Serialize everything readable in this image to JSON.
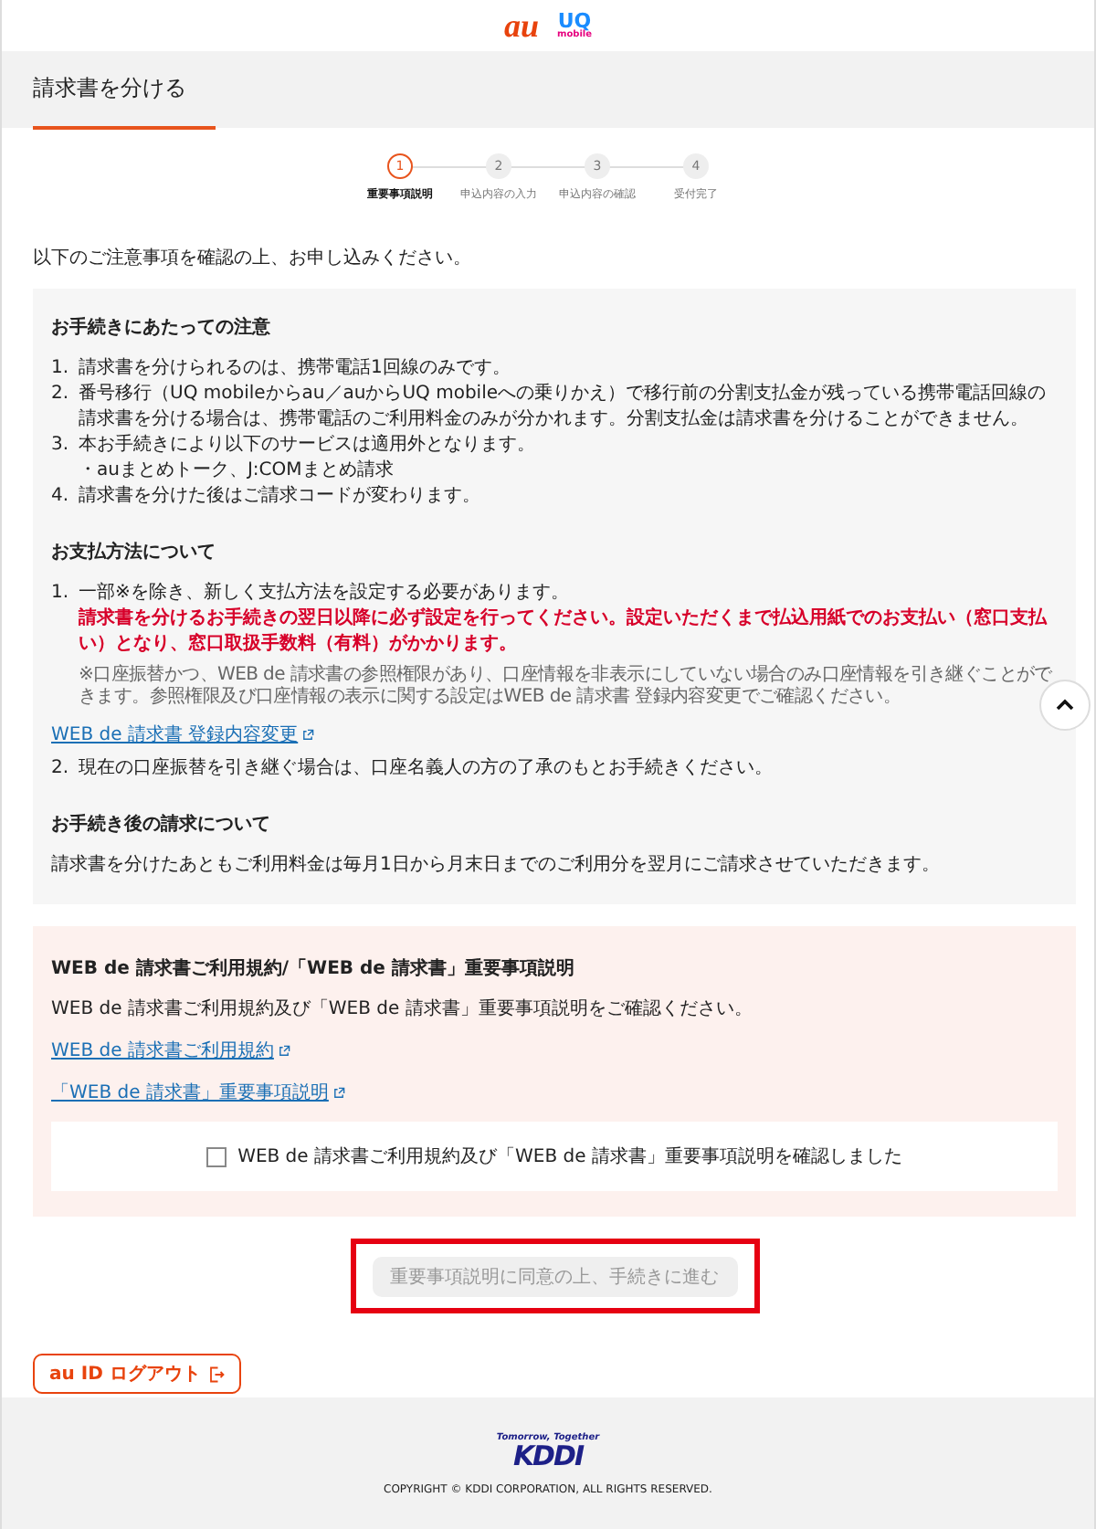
{
  "header": {
    "au_logo": "au",
    "uq_logo": "UQ",
    "uq_sub": "mobile"
  },
  "page_title": "請求書を分ける",
  "steps": [
    {
      "number": "1",
      "label": "重要事項説明",
      "selected": true
    },
    {
      "number": "2",
      "label": "申込内容の入力",
      "selected": false
    },
    {
      "number": "3",
      "label": "申込内容の確認",
      "selected": false
    },
    {
      "number": "4",
      "label": "受付完了",
      "selected": false
    }
  ],
  "intro": "以下のご注意事項を確認の上、お申し込みください。",
  "notice": {
    "sections": [
      {
        "kind": "list",
        "heading": "お手続きにあたっての注意",
        "items": [
          {
            "number": "1.",
            "text": "請求書を分けられるのは、携帯電話1回線のみです。"
          },
          {
            "number": "2.",
            "text": "番号移行（UQ mobileからau／auからUQ mobileへの乗りかえ）で移行前の分割支払金が残っている携帯電話回線の請求書を分ける場合は、携帯電話のご利用料金のみが分かれます。分割支払金は請求書を分けることができません。"
          },
          {
            "number": "3.",
            "text": "本お手続きにより以下のサービスは適用外となります。",
            "sub": "・auまとめトーク、J:COMまとめ請求"
          },
          {
            "number": "4.",
            "text": "請求書を分けた後はご請求コードが変わります。"
          }
        ]
      },
      {
        "kind": "list",
        "heading": "お支払方法について",
        "items": [
          {
            "number": "1.",
            "text": "一部※を除き、新しく支払方法を設定する必要があります。",
            "warning": "請求書を分けるお手続きの翌日以降に必ず設定を行ってください。設定いただくまで払込用紙でのお支払い（窓口支払い）となり、窓口取扱手数料（有料）がかかります。",
            "note": "※口座振替かつ、WEB de 請求書の参照権限があり、口座情報を非表示にしていない場合のみ口座情報を引き継ぐことができます。参照権限及び口座情報の表示に関する設定はWEB de 請求書 登録内容変更でご確認ください。",
            "link": "WEB de 請求書 登録内容変更"
          },
          {
            "number": "2.",
            "text": "現在の口座振替を引き継ぐ場合は、口座名義人の方の了承のもとお手続きください。"
          }
        ]
      },
      {
        "kind": "paragraph",
        "heading": "お手続き後の請求について",
        "text": "請求書を分けたあともご利用料金は毎月1日から月末日までのご利用分を翌月にご請求させていただきます。"
      }
    ]
  },
  "terms": {
    "heading": "WEB de 請求書ご利用規約/「WEB de 請求書」重要事項説明",
    "text": "WEB de 請求書ご利用規約及び「WEB de 請求書」重要事項説明をご確認ください。",
    "links": [
      "WEB de 請求書ご利用規約",
      "「WEB de 請求書」重要事項説明"
    ],
    "checkbox": {
      "label": "WEB de 請求書ご利用規約及び「WEB de 請求書」重要事項説明を確認しました",
      "checked": false
    }
  },
  "proceed_button": {
    "label": "重要事項説明に同意の上、手続きに進む",
    "disabled": true,
    "highlighted": true
  },
  "logout_button": {
    "label": "au ID ログアウト"
  },
  "footer": {
    "tagline": "Tomorrow, Together",
    "logo": "KDDI",
    "copyright": "COPYRIGHT © KDDI CORPORATION, ALL RIGHTS RESERVED."
  }
}
